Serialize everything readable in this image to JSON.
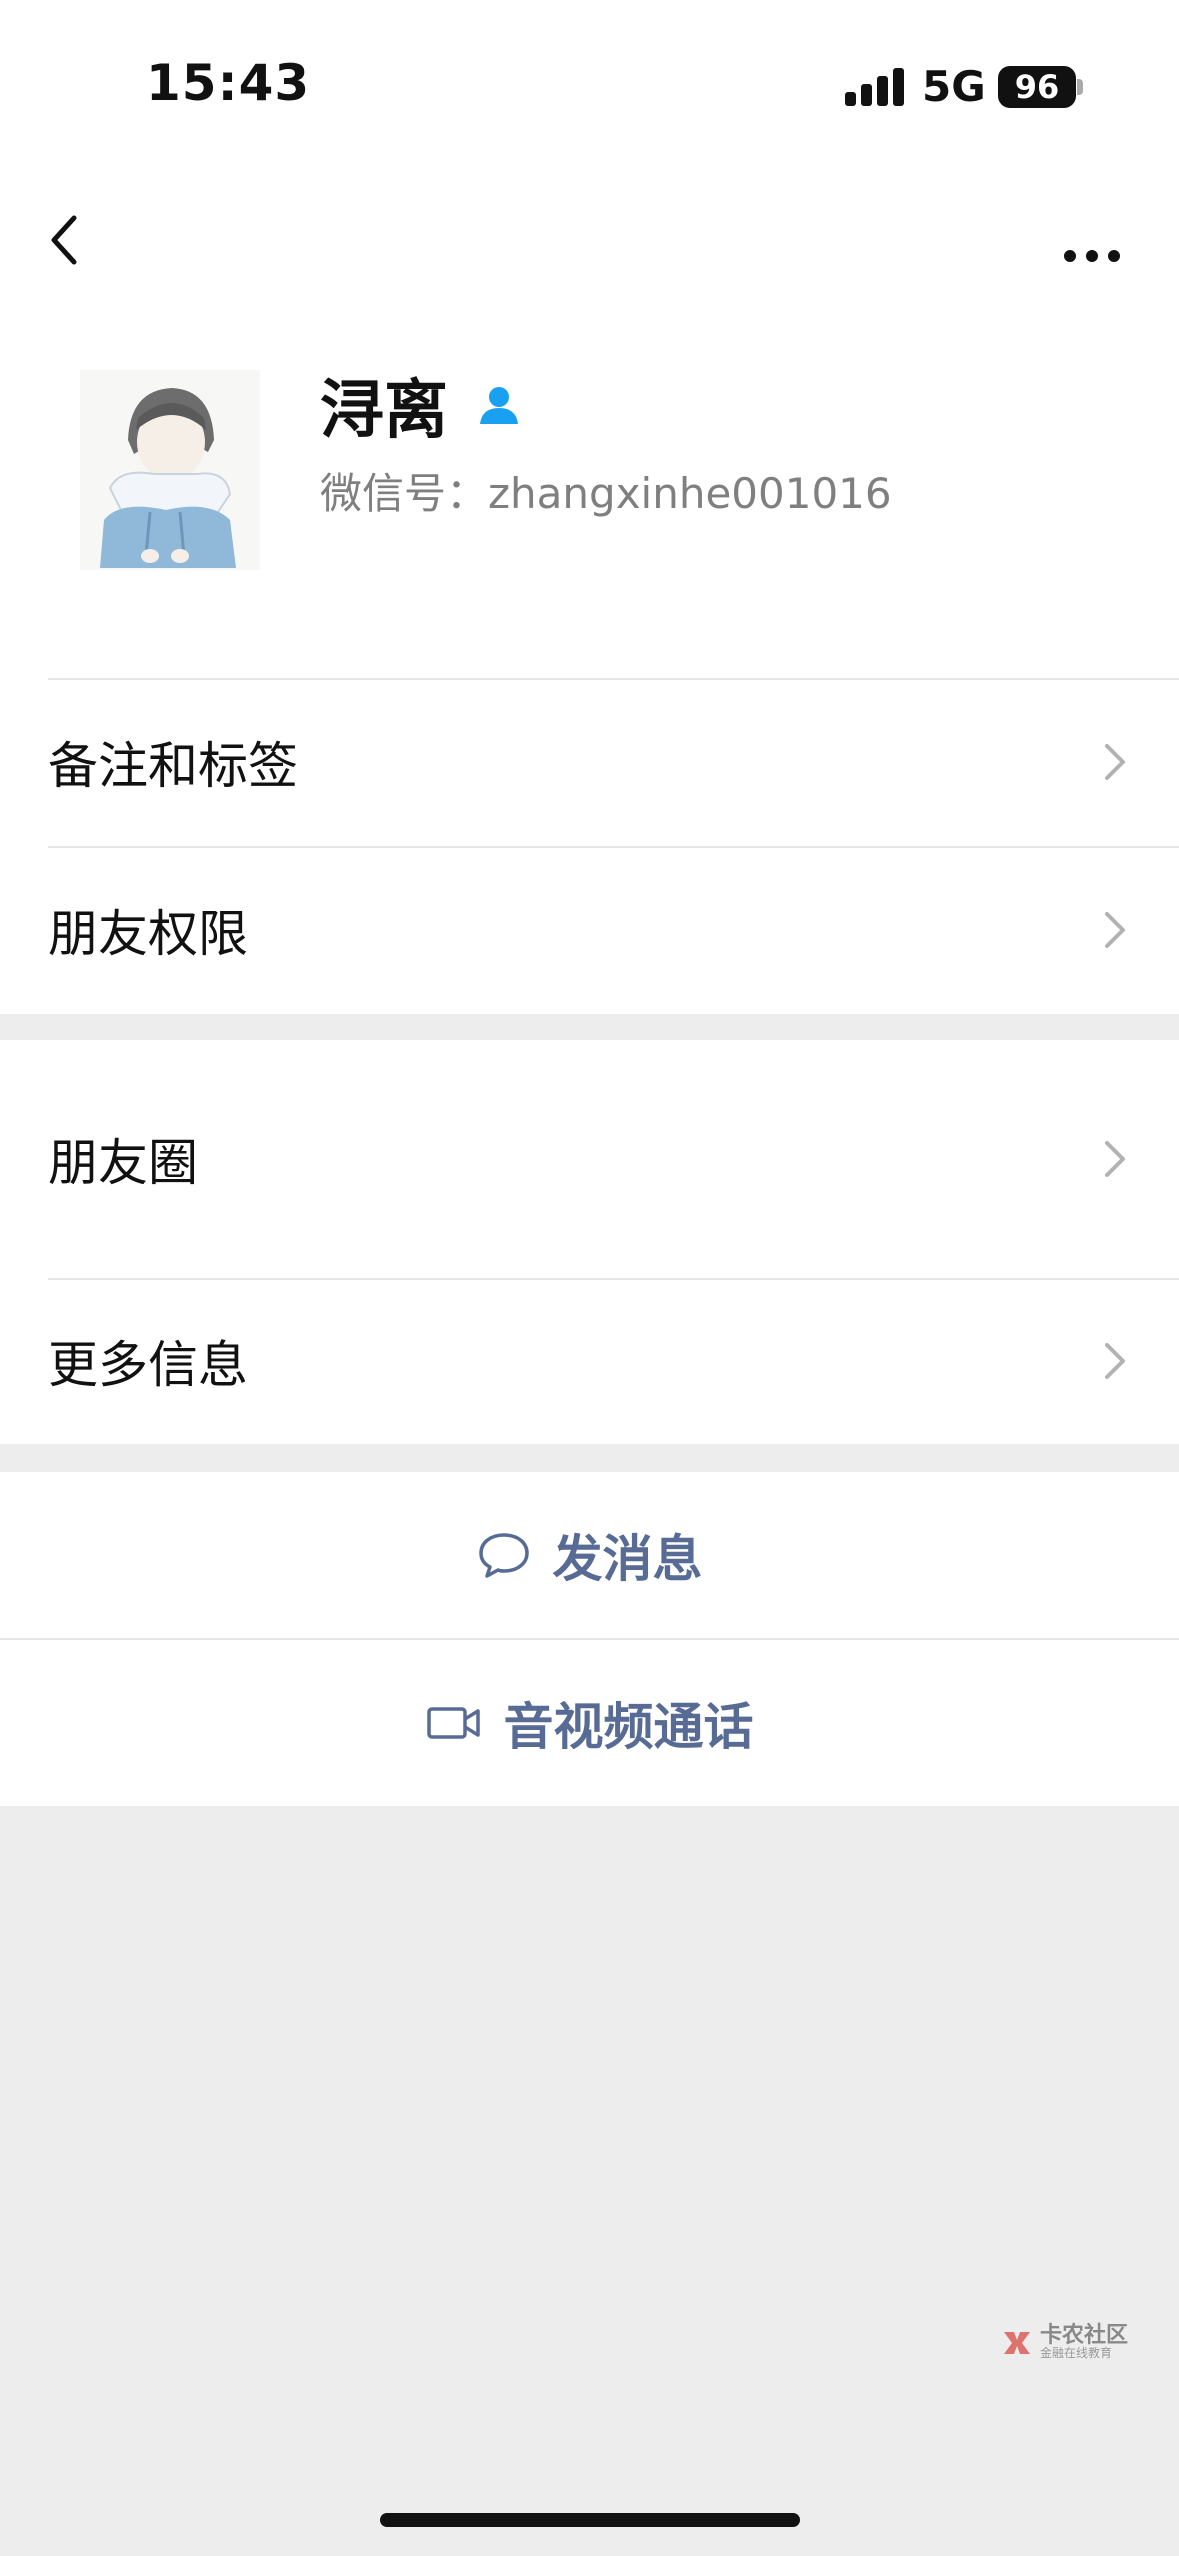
{
  "status_bar": {
    "time": "15:43",
    "network": "5G",
    "battery": "96"
  },
  "nav": {
    "back_icon": "chevron-left-icon",
    "more_icon": "more-horizontal-icon"
  },
  "profile": {
    "name": "浔离",
    "wechat_id_label": "微信号：",
    "wechat_id": "zhangxinhe001016",
    "badge_icon": "person-icon"
  },
  "groups": [
    {
      "items": [
        {
          "label": "备注和标签"
        },
        {
          "label": "朋友权限"
        }
      ]
    },
    {
      "items": [
        {
          "label": "朋友圈"
        },
        {
          "label": "更多信息"
        }
      ]
    }
  ],
  "actions": {
    "message": {
      "label": "发消息",
      "icon": "chat-bubble-icon"
    },
    "call": {
      "label": "音视频通话",
      "icon": "video-camera-icon"
    }
  },
  "watermark": {
    "title": "卡农社区",
    "subtitle": "金融在线教育"
  },
  "colors": {
    "link": "#576b95",
    "background": "#ededed",
    "badge": "#1aa0f0"
  }
}
